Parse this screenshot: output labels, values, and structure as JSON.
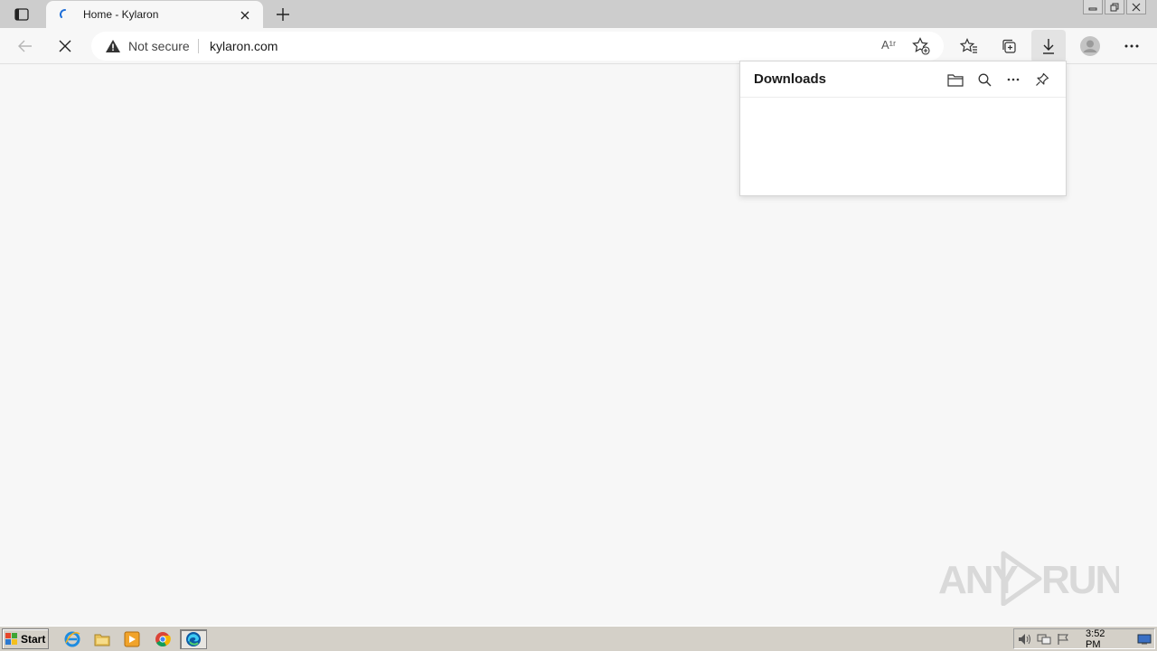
{
  "browser": {
    "tab": {
      "title": "Home - Kylaron"
    },
    "address": {
      "security": "Not secure",
      "url": "kylaron.com"
    },
    "read_aloud_label": "A¹ʳ"
  },
  "downloads_panel": {
    "title": "Downloads"
  },
  "watermark": {
    "text": "ANY RUN"
  },
  "taskbar": {
    "start_label": "Start",
    "clock": "3:52 PM"
  },
  "colors": {
    "accent_edge": "#0078d4",
    "loading_spinner": "#1e6fd9",
    "watermark": "#d9d9d9"
  }
}
